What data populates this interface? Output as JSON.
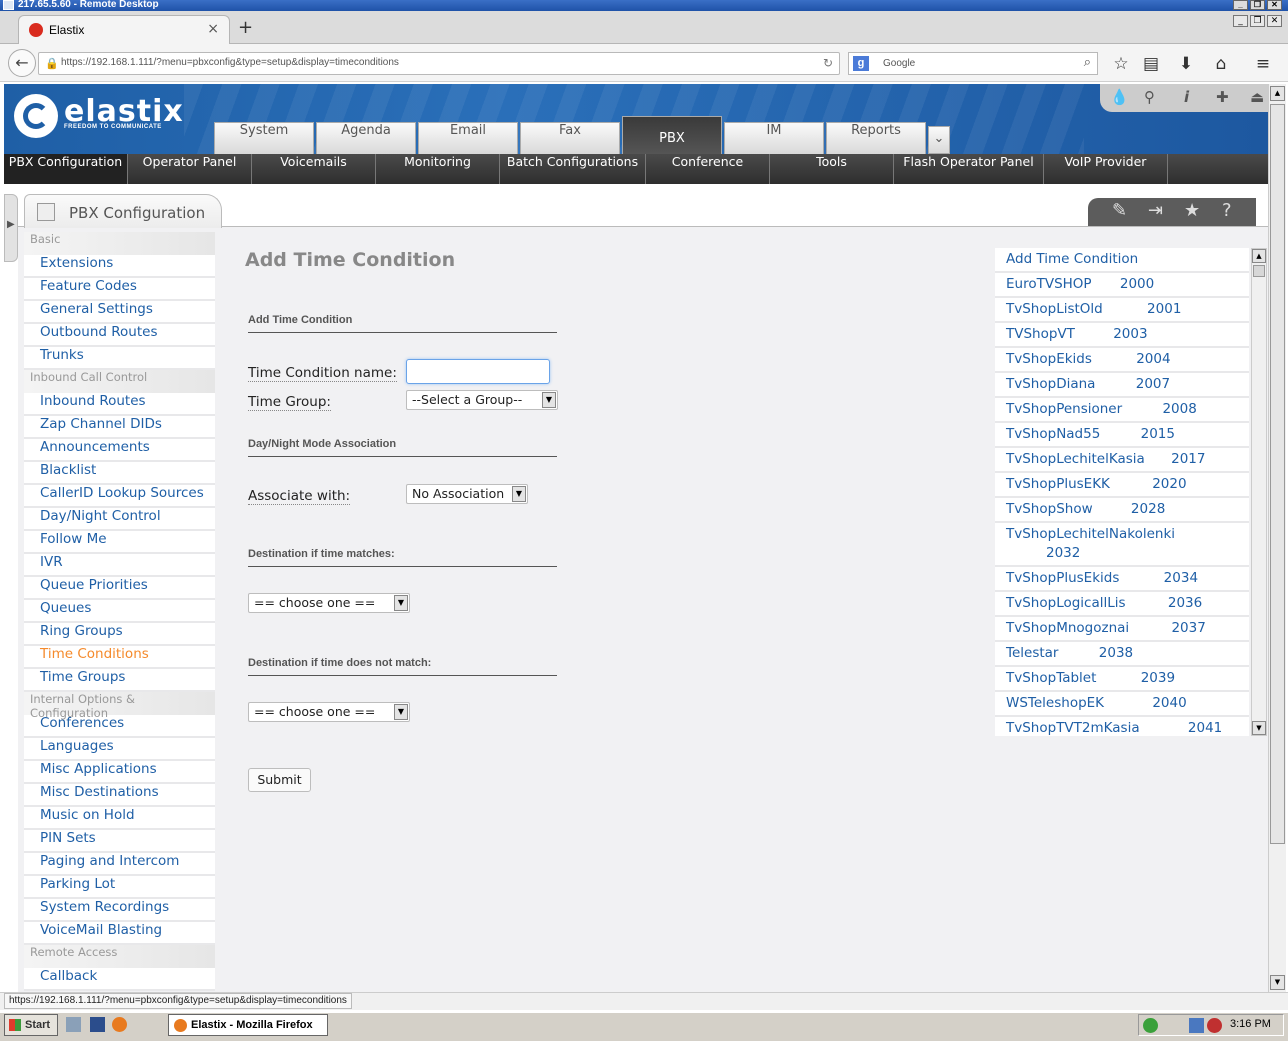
{
  "remote_desktop": {
    "title": "217.65.5.60 - Remote Desktop"
  },
  "browser": {
    "tab_title": "Elastix",
    "url": "https://192.168.1.111/?menu=pbxconfig&type=setup&display=timeconditions",
    "search_placeholder": "Google",
    "status_url": "https://192.168.1.111/?menu=pbxconfig&type=setup&display=timeconditions"
  },
  "header": {
    "logo_text": "elastix",
    "logo_tagline": "FREEDOM TO COMMUNICATE",
    "main_tabs": [
      "System",
      "Agenda",
      "Email",
      "Fax",
      "PBX",
      "IM",
      "Reports"
    ],
    "active_main_tab": "PBX",
    "sub_menu": [
      "PBX Configuration",
      "Operator Panel",
      "Voicemails",
      "Monitoring",
      "Batch Configurations",
      "Conference",
      "Tools",
      "Flash Operator Panel",
      "VoIP Provider"
    ]
  },
  "module": {
    "title": "PBX Configuration"
  },
  "sidebar": {
    "sections": [
      {
        "title": "Basic",
        "items": [
          "Extensions",
          "Feature Codes",
          "General Settings",
          "Outbound Routes",
          "Trunks"
        ]
      },
      {
        "title": "Inbound Call Control",
        "items": [
          "Inbound Routes",
          "Zap Channel DIDs",
          "Announcements",
          "Blacklist",
          "CallerID Lookup Sources",
          "Day/Night Control",
          "Follow Me",
          "IVR",
          "Queue Priorities",
          "Queues",
          "Ring Groups",
          "Time Conditions",
          "Time Groups"
        ]
      },
      {
        "title": "Internal Options & Configuration",
        "items": [
          "Conferences",
          "Languages",
          "Misc Applications",
          "Misc Destinations",
          "Music on Hold",
          "PIN Sets",
          "Paging and Intercom",
          "Parking Lot",
          "System Recordings",
          "VoiceMail Blasting"
        ]
      },
      {
        "title": "Remote Access",
        "items": [
          "Callback"
        ]
      }
    ],
    "active_item": "Time Conditions"
  },
  "form": {
    "title": "Add Time Condition",
    "section_add": "Add Time Condition",
    "name_label": "Time Condition name:",
    "name_value": "",
    "group_label": "Time Group:",
    "group_value": "--Select a Group--",
    "section_daynight": "Day/Night Mode Association",
    "assoc_label": "Associate with:",
    "assoc_value": "No Association",
    "section_match": "Destination if time matches:",
    "match_value": "== choose one ==",
    "section_nomatch": "Destination if time does not match:",
    "nomatch_value": "== choose one ==",
    "submit_label": "Submit"
  },
  "right_list": [
    {
      "label": "Add Time Condition"
    },
    {
      "label": "EuroTVSHOP",
      "suffix": "2000"
    },
    {
      "label": "TvShopListOld",
      "suffix": "2001"
    },
    {
      "label": "TVShopVT",
      "suffix": "2003"
    },
    {
      "label": "TvShopEkids",
      "suffix": "2004"
    },
    {
      "label": "TvShopDiana",
      "suffix": "2007"
    },
    {
      "label": "TvShopPensioner",
      "suffix": "2008"
    },
    {
      "label": "TvShopNad55",
      "suffix": "2015"
    },
    {
      "label": "TvShopLechitelKasia",
      "suffix": "2017"
    },
    {
      "label": "TvShopPlusEKK",
      "suffix": "2020"
    },
    {
      "label": "TvShopShow",
      "suffix": "2028"
    },
    {
      "label": "TvShopLechitelNakolenki",
      "suffix": "2032"
    },
    {
      "label": "TvShopPlusEkids",
      "suffix": "2034"
    },
    {
      "label": "TvShopLogicallLis",
      "suffix": "2036"
    },
    {
      "label": "TvShopMnogoznai",
      "suffix": "2037"
    },
    {
      "label": "Telestar",
      "suffix": "2038"
    },
    {
      "label": "TvShopTablet",
      "suffix": "2039"
    },
    {
      "label": "WSTeleshopEK",
      "suffix": "2040"
    },
    {
      "label": "TvShopTVT2mKasia",
      "suffix": "2041"
    }
  ],
  "taskbar": {
    "start_label": "Start",
    "task_label": "Elastix - Mozilla Firefox",
    "clock": "3:16 PM"
  },
  "colors": {
    "brand_blue": "#1f5fa6",
    "active_orange": "#f58a2b",
    "submenu_dark": "#2e2e2e"
  }
}
